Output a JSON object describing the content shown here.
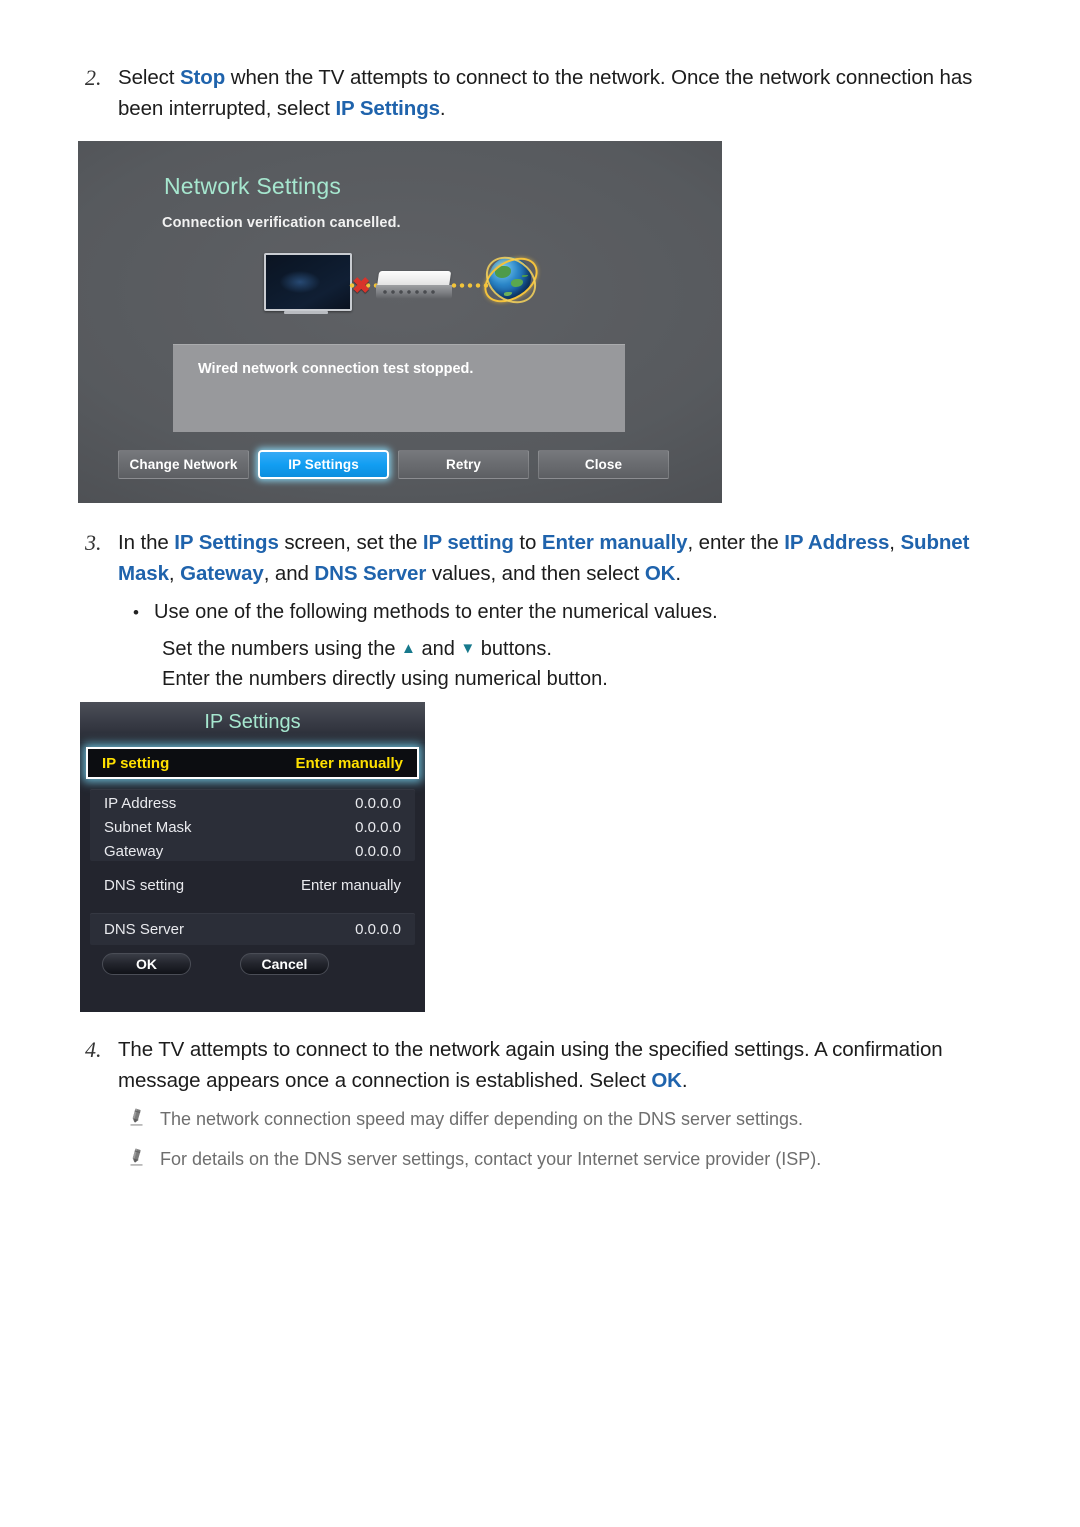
{
  "colors": {
    "link_blue": "#1f63ac",
    "osd_title_green": "#a6e7cf",
    "osd_highlight_yellow": "#ffe000",
    "osd_accent_blue": "#129ef2",
    "note_gray": "#6e6e6e",
    "triangle_teal": "#17798c"
  },
  "steps": {
    "step2": {
      "number": "2.",
      "text_parts": [
        {
          "t": "Select ",
          "link": false
        },
        {
          "t": "Stop",
          "link": true
        },
        {
          "t": " when the TV attempts to connect to the network. Once the network connection has been interrupted, select ",
          "link": false
        },
        {
          "t": "IP Settings",
          "link": true
        },
        {
          "t": ".",
          "link": false
        }
      ]
    },
    "step3": {
      "number": "3.",
      "text_parts": [
        {
          "t": "In the ",
          "link": false
        },
        {
          "t": "IP Settings",
          "link": true
        },
        {
          "t": " screen, set the ",
          "link": false
        },
        {
          "t": "IP setting",
          "link": true
        },
        {
          "t": " to ",
          "link": false
        },
        {
          "t": "Enter manually",
          "link": true
        },
        {
          "t": ", enter the ",
          "link": false
        },
        {
          "t": "IP Address",
          "link": true
        },
        {
          "t": ", ",
          "link": false
        },
        {
          "t": "Subnet Mask",
          "link": true
        },
        {
          "t": ", ",
          "link": false
        },
        {
          "t": "Gateway",
          "link": true
        },
        {
          "t": ", and ",
          "link": false
        },
        {
          "t": "DNS Server",
          "link": true
        },
        {
          "t": " values, and then select ",
          "link": false
        },
        {
          "t": "OK",
          "link": true
        },
        {
          "t": ".",
          "link": false
        }
      ],
      "bullet": "Use one of the following methods to enter the numerical values.",
      "sub_line_1_before": "Set the numbers using the ",
      "sub_line_1_up": "▲",
      "sub_line_1_mid": " and ",
      "sub_line_1_down": "▼",
      "sub_line_1_after": " buttons.",
      "sub_line_2": "Enter the numbers directly using numerical button."
    },
    "step4": {
      "number": "4.",
      "text_parts": [
        {
          "t": "The TV attempts to connect to the network again using the specified settings. A confirmation message appears once a connection is established. Select ",
          "link": false
        },
        {
          "t": "OK",
          "link": true
        },
        {
          "t": ".",
          "link": false
        }
      ]
    }
  },
  "notes": [
    {
      "icon": "pencil-icon",
      "text": "The network connection speed may differ depending on the DNS server settings."
    },
    {
      "icon": "pencil-icon",
      "text": "For details on the DNS server settings, contact your Internet service provider (ISP)."
    }
  ],
  "network_settings_screen": {
    "title": "Network Settings",
    "subtitle": "Connection verification cancelled.",
    "message": "Wired network connection test stopped.",
    "illustration": {
      "tv": "tv-device-icon",
      "error": "red-x-icon",
      "router": "router-icon",
      "globe": "globe-internet-icon"
    },
    "buttons": [
      {
        "label": "Change Network",
        "selected": false
      },
      {
        "label": "IP Settings",
        "selected": true
      },
      {
        "label": "Retry",
        "selected": false
      },
      {
        "label": "Close",
        "selected": false
      }
    ]
  },
  "ip_settings_screen": {
    "title": "IP Settings",
    "selected_row": {
      "key": "IP setting",
      "value": "Enter manually"
    },
    "group_rows": [
      {
        "key": "IP Address",
        "value": "0.0.0.0"
      },
      {
        "key": "Subnet Mask",
        "value": "0.0.0.0"
      },
      {
        "key": "Gateway",
        "value": "0.0.0.0"
      }
    ],
    "dns_setting": {
      "key": "DNS setting",
      "value": "Enter manually"
    },
    "dns_server": {
      "key": "DNS Server",
      "value": "0.0.0.0"
    },
    "buttons": [
      {
        "label": "OK"
      },
      {
        "label": "Cancel"
      }
    ]
  }
}
